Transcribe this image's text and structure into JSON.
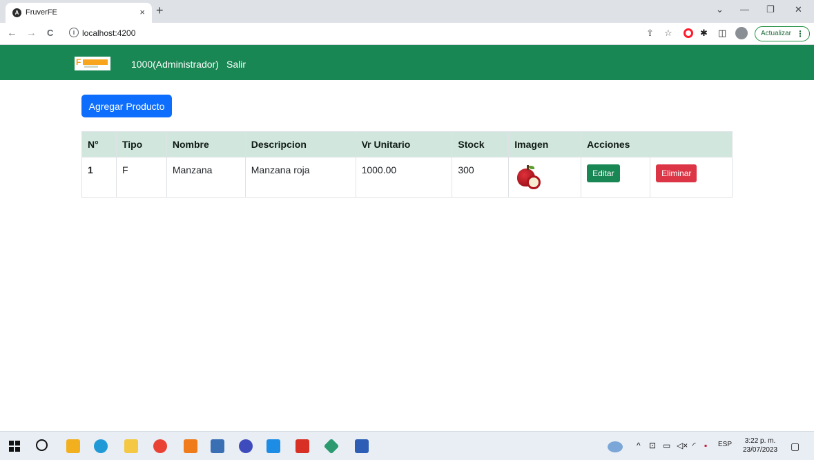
{
  "browser": {
    "tab_title": "FruverFE",
    "tab_close": "×",
    "new_tab": "+",
    "window_controls": {
      "dropdown": "⌄",
      "minimize": "—",
      "restore": "❐",
      "close": "✕"
    },
    "nav": {
      "back": "←",
      "forward": "→",
      "reload": "C"
    },
    "address_info_icon": "i",
    "url": "localhost:4200",
    "update_button_label": "Actualizar",
    "update_dots": "⋮"
  },
  "app": {
    "colors": {
      "navbar": "#198754",
      "primary": "#0d6efd",
      "success": "#198754",
      "danger": "#dc3545",
      "table_header": "#d1e7dd"
    },
    "navbar": {
      "logo_letter": "F",
      "user_label": "1000(Administrador)",
      "logout_label": "Salir"
    },
    "add_product_label": "Agregar Producto",
    "table": {
      "headers": [
        "N°",
        "Tipo",
        "Nombre",
        "Descripcion",
        "Vr Unitario",
        "Stock",
        "Imagen",
        "Acciones"
      ],
      "rows": [
        {
          "num": "1",
          "tipo": "F",
          "nombre": "Manzana",
          "descripcion": "Manzana roja",
          "vr_unitario": "1000.00",
          "stock": "300",
          "imagen": "apple-image",
          "edit_label": "Editar",
          "delete_label": "Eliminar"
        }
      ]
    }
  },
  "taskbar": {
    "tray_language": "ESP",
    "tray_chevron": "^",
    "clock_time": "3:22 p. m.",
    "clock_date": "23/07/2023"
  }
}
